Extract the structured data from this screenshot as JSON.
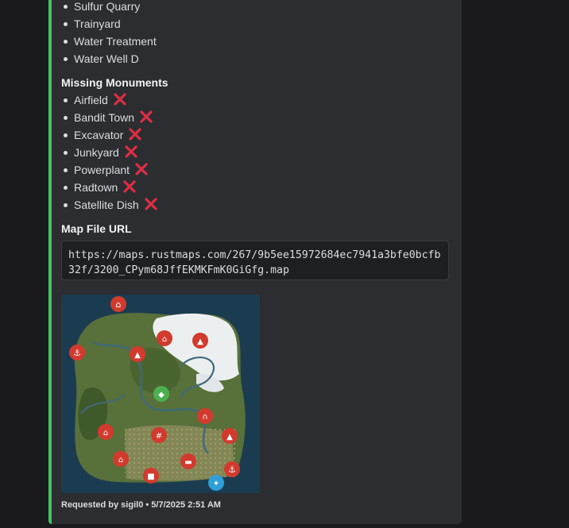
{
  "existing_list": {
    "items": [
      "Sulfur Quarry",
      "Trainyard",
      "Water Treatment",
      "Water Well D"
    ]
  },
  "missing": {
    "heading": "Missing Monuments",
    "status_icon": "cross-mark-icon",
    "items": [
      "Airfield",
      "Bandit Town",
      "Excavator",
      "Junkyard",
      "Powerplant",
      "Radtown",
      "Satellite Dish"
    ]
  },
  "map_file": {
    "heading": "Map File URL",
    "url": "https://maps.rustmaps.com/267/9b5ee15972684ec7941a3bfe0bcfb32f/3200_CPym68JffEKMKFmK0GiGfg.map"
  },
  "map_image": {
    "icon": "map-image",
    "marker_color": "#d23a2e",
    "accent_marker_color": "#4caf50"
  },
  "footer": {
    "requested_by": "Requested by sigil0",
    "separator": "•",
    "timestamp": "5/7/2025 2:51 AM"
  },
  "colors": {
    "embed_accent": "#3fc55c",
    "embed_bg": "#2b2d31",
    "cross_red": "#dd2e44"
  }
}
